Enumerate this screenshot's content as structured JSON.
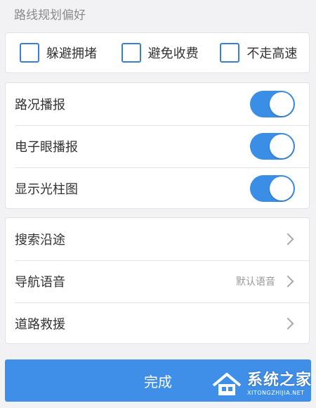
{
  "header": {
    "title": "路线规划偏好"
  },
  "route_preferences": [
    {
      "label": "躲避拥堵",
      "checked": false
    },
    {
      "label": "避免收费",
      "checked": false
    },
    {
      "label": "不走高速",
      "checked": false
    }
  ],
  "toggles": [
    {
      "label": "路况播报",
      "on": true
    },
    {
      "label": "电子眼播报",
      "on": true
    },
    {
      "label": "显示光柱图",
      "on": true
    }
  ],
  "list": [
    {
      "label": "搜索沿途",
      "value": ""
    },
    {
      "label": "导航语音",
      "value": "默认语音"
    },
    {
      "label": "道路救援",
      "value": ""
    }
  ],
  "footer": {
    "done_label": "完成"
  },
  "watermark": {
    "name": "系统之家",
    "domain": "XITONGZHIJIA.NET"
  },
  "colors": {
    "accent": "#3f8ee8",
    "checkbox_border": "#3a7fd0",
    "background": "#f2f2f4"
  }
}
